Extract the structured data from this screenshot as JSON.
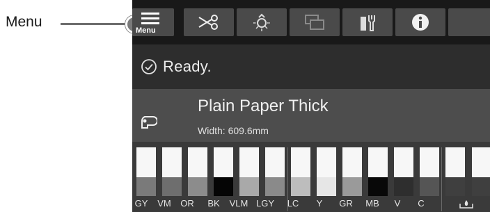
{
  "callout": {
    "label": "Menu"
  },
  "toolbar": {
    "menu_label": "Menu",
    "buttons": [
      "menu-icon",
      "scissors-icon",
      "light-bulb-icon",
      "layout-icon",
      "maintenance-icon",
      "info-icon"
    ]
  },
  "status": {
    "icon": "check-circle-icon",
    "text": "Ready."
  },
  "paper": {
    "icon": "paper-roll-icon",
    "name": "Plain Paper Thick",
    "width": "Width: 609.6mm"
  },
  "inks": [
    {
      "label": "GY",
      "color": "#7a7a7a"
    },
    {
      "label": "VM",
      "color": "#6e6e6e"
    },
    {
      "label": "OR",
      "color": "#8c8c8c"
    },
    {
      "label": "BK",
      "color": "#050505"
    },
    {
      "label": "VLM",
      "color": "#a9a9a9"
    },
    {
      "label": "LGY",
      "color": "#8a8a8a"
    },
    {
      "label": "LC",
      "color": "#bdbdbd"
    },
    {
      "label": "Y",
      "color": "#e6e6e6"
    },
    {
      "label": "GR",
      "color": "#9a9a9a"
    },
    {
      "label": "MB",
      "color": "#080808"
    },
    {
      "label": "V",
      "color": "#2e2e2e"
    },
    {
      "label": "C",
      "color": "#555555"
    }
  ],
  "maintenance": {
    "icon": "maintenance-box-icon"
  }
}
